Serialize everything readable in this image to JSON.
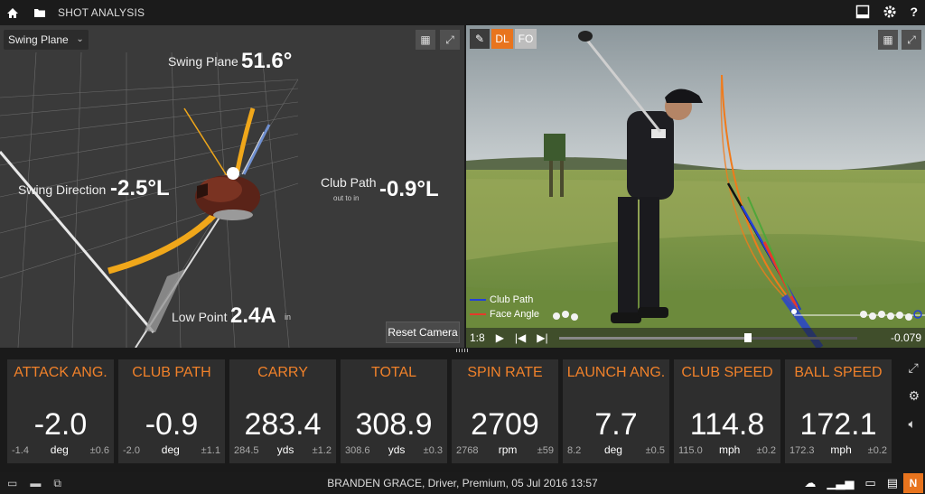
{
  "window": {
    "title": "SHOT ANALYSIS"
  },
  "view3d": {
    "view_select": "Swing Plane",
    "swing_plane": {
      "label": "Swing Plane",
      "value": "51.6°"
    },
    "swing_direction": {
      "label": "Swing Direction",
      "value": "-2.5°L"
    },
    "club_path": {
      "label": "Club Path",
      "sublabel": "out to in",
      "value": "-0.9°L"
    },
    "low_point": {
      "label": "Low Point",
      "value": "2.4A",
      "unit": "in"
    },
    "reset_label": "Reset Camera"
  },
  "video": {
    "tools": {
      "dl": "DL",
      "fo": "FO"
    },
    "legend": [
      {
        "label": "Club Path",
        "color": "#2340d8"
      },
      {
        "label": "Face Angle",
        "color": "#e53a2a"
      }
    ],
    "speed": "1:8",
    "time": "-0.079"
  },
  "stats": [
    {
      "title": "ATTACK ANG.",
      "value": "-2.0",
      "min": "-1.4",
      "unit": "deg",
      "dev": "±0.6"
    },
    {
      "title": "CLUB PATH",
      "value": "-0.9",
      "min": "-2.0",
      "unit": "deg",
      "dev": "±1.1"
    },
    {
      "title": "CARRY",
      "value": "283.4",
      "min": "284.5",
      "unit": "yds",
      "dev": "±1.2"
    },
    {
      "title": "TOTAL",
      "value": "308.9",
      "min": "308.6",
      "unit": "yds",
      "dev": "±0.3"
    },
    {
      "title": "SPIN RATE",
      "value": "2709",
      "min": "2768",
      "unit": "rpm",
      "dev": "±59"
    },
    {
      "title": "LAUNCH ANG.",
      "value": "7.7",
      "min": "8.2",
      "unit": "deg",
      "dev": "±0.5"
    },
    {
      "title": "CLUB SPEED",
      "value": "114.8",
      "min": "115.0",
      "unit": "mph",
      "dev": "±0.2"
    },
    {
      "title": "BALL SPEED",
      "value": "172.1",
      "min": "172.3",
      "unit": "mph",
      "dev": "±0.2"
    }
  ],
  "footer": {
    "info": "BRANDEN GRACE, Driver, Premium, 05 Jul 2016 13:57",
    "n_label": "N"
  },
  "colors": {
    "accent": "#f0812a",
    "bg": "#1a1a1a",
    "tile": "#2e2e2e"
  }
}
